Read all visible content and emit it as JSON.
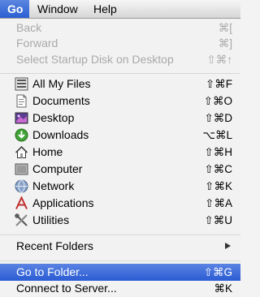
{
  "menubar": {
    "go": "Go",
    "window": "Window",
    "help": "Help"
  },
  "menu": {
    "back": {
      "label": "Back",
      "shortcut": "⌘["
    },
    "forward": {
      "label": "Forward",
      "shortcut": "⌘]"
    },
    "startup_disk": {
      "label": "Select Startup Disk on Desktop",
      "shortcut": "⇧⌘↑"
    },
    "items": [
      {
        "label": "All My Files",
        "shortcut": "⇧⌘F",
        "icon": "all-files-icon"
      },
      {
        "label": "Documents",
        "shortcut": "⇧⌘O",
        "icon": "documents-icon"
      },
      {
        "label": "Desktop",
        "shortcut": "⇧⌘D",
        "icon": "desktop-icon"
      },
      {
        "label": "Downloads",
        "shortcut": "⌥⌘L",
        "icon": "downloads-icon"
      },
      {
        "label": "Home",
        "shortcut": "⇧⌘H",
        "icon": "home-icon"
      },
      {
        "label": "Computer",
        "shortcut": "⇧⌘C",
        "icon": "computer-icon"
      },
      {
        "label": "Network",
        "shortcut": "⇧⌘K",
        "icon": "network-icon"
      },
      {
        "label": "Applications",
        "shortcut": "⇧⌘A",
        "icon": "applications-icon"
      },
      {
        "label": "Utilities",
        "shortcut": "⇧⌘U",
        "icon": "utilities-icon"
      }
    ],
    "recent_folders": {
      "label": "Recent Folders"
    },
    "go_to_folder": {
      "label": "Go to Folder...",
      "shortcut": "⇧⌘G"
    },
    "connect_server": {
      "label": "Connect to Server...",
      "shortcut": "⌘K"
    }
  },
  "colors": {
    "selection": "#2a5cd3",
    "disabled_text": "#a9a9a9"
  }
}
